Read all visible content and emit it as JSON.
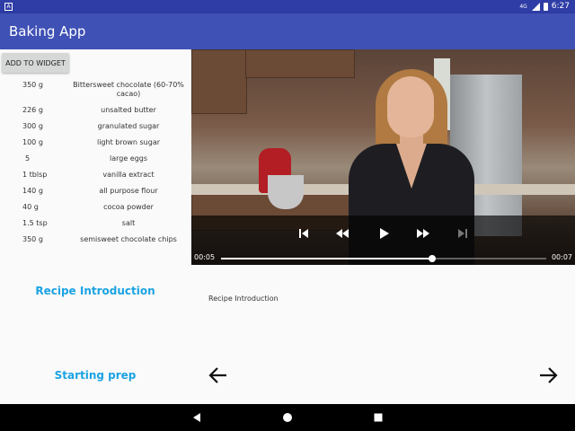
{
  "status_bar": {
    "time": "6:27",
    "network": "4G"
  },
  "app_bar": {
    "title": "Baking App"
  },
  "widget_button": {
    "label": "ADD TO WIDGET"
  },
  "ingredients": [
    {
      "qty": "350 g",
      "name": "Bittersweet chocolate (60-70% cacao)"
    },
    {
      "qty": "226 g",
      "name": "unsalted butter"
    },
    {
      "qty": "300 g",
      "name": "granulated sugar"
    },
    {
      "qty": "100 g",
      "name": "light brown sugar"
    },
    {
      "qty": "5",
      "name": "large eggs"
    },
    {
      "qty": "1 tblsp",
      "name": "vanilla extract"
    },
    {
      "qty": "140 g",
      "name": "all purpose flour"
    },
    {
      "qty": "40 g",
      "name": "cocoa powder"
    },
    {
      "qty": "1.5 tsp",
      "name": "salt"
    },
    {
      "qty": "350 g",
      "name": "semisweet chocolate chips"
    }
  ],
  "steps": [
    {
      "label": "Recipe Introduction"
    },
    {
      "label": "Starting prep"
    }
  ],
  "player": {
    "position": "00:05",
    "duration": "00:07",
    "progress": 0.65
  },
  "step_description": "Recipe Introduction",
  "colors": {
    "app_bar": "#3f51b5",
    "status_bar": "#2f3da6",
    "accent": "#1ba3e3"
  }
}
